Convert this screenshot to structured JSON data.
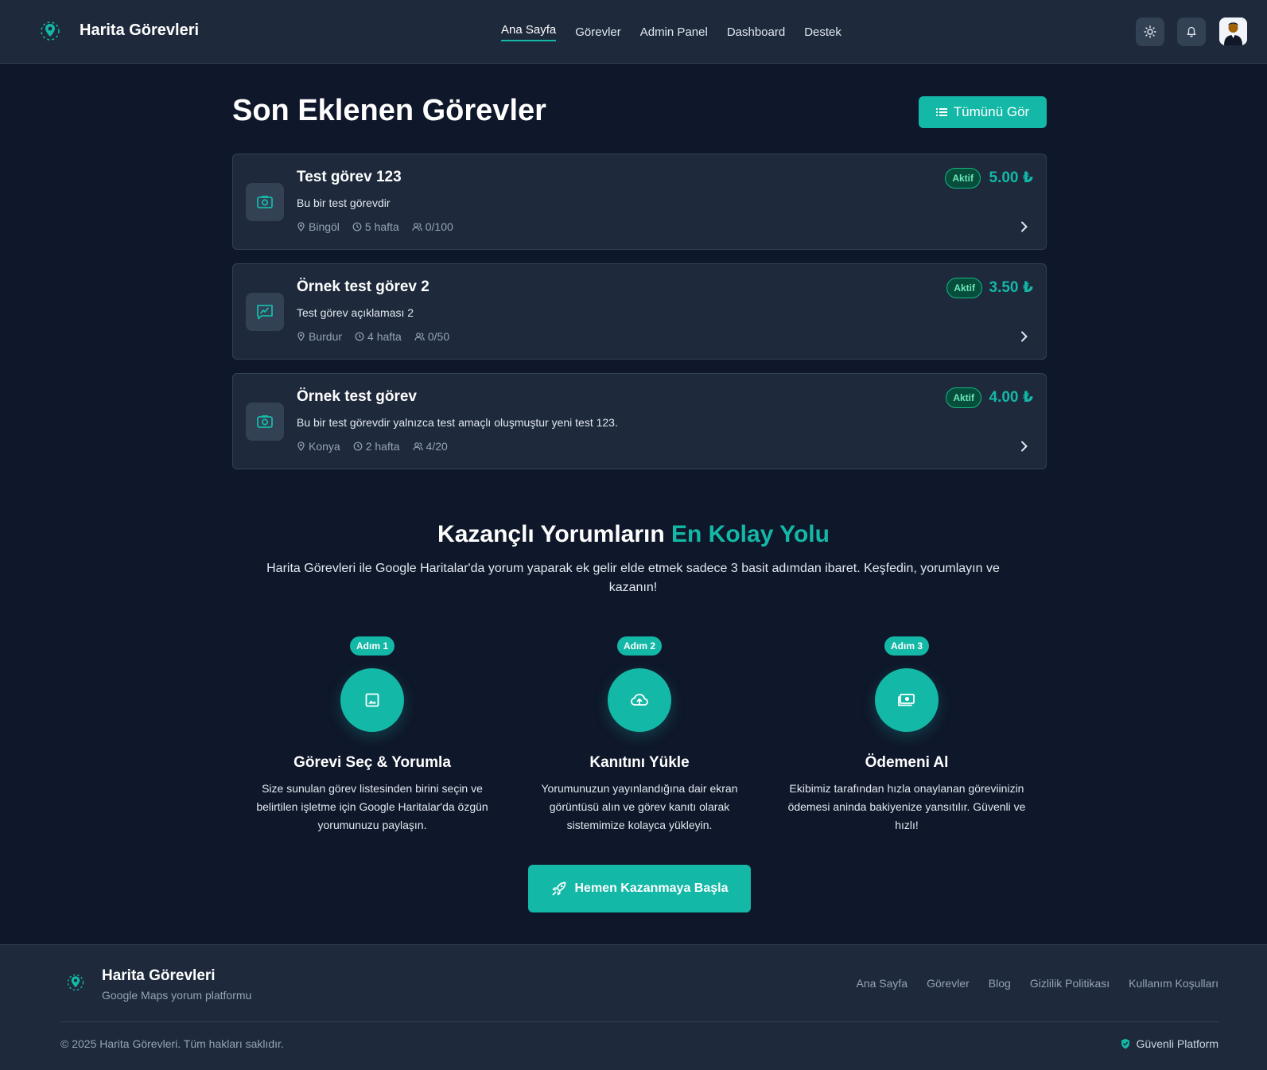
{
  "header": {
    "brand": "Harita Görevleri",
    "nav": [
      "Ana Sayfa",
      "Görevler",
      "Admin Panel",
      "Dashboard",
      "Destek"
    ],
    "active_nav": "Ana Sayfa"
  },
  "recent": {
    "title": "Son Eklenen Görevler",
    "see_all": "Tümünü Gör"
  },
  "tasks": [
    {
      "title": "Test görev 123",
      "description": "Bu bir test görevdir",
      "location": "Bingöl",
      "duration": "5 hafta",
      "participants": "0/100",
      "status": "Aktif",
      "price": "5.00 ₺",
      "icon": "camera-icon"
    },
    {
      "title": "Örnek test görev 2",
      "description": "Test görev açıklaması 2",
      "location": "Burdur",
      "duration": "4 hafta",
      "participants": "0/50",
      "status": "Aktif",
      "price": "3.50 ₺",
      "icon": "review-icon"
    },
    {
      "title": "Örnek test görev",
      "description": "Bu bir test görevdir yalnızca test amaçlı oluşmuştur yeni test 123.",
      "location": "Konya",
      "duration": "2 hafta",
      "participants": "4/20",
      "status": "Aktif",
      "price": "4.00 ₺",
      "icon": "camera-icon"
    }
  ],
  "how": {
    "title_main": "Kazançlı Yorumların ",
    "title_accent": "En Kolay Yolu",
    "subtitle": "Harita Görevleri ile Google Haritalar'da yorum yaparak ek gelir elde etmek sadece 3 basit adımdan ibaret. Keşfedin, yorumlayın ve kazanın!",
    "steps": [
      {
        "badge": "Adım 1",
        "title": "Görevi Seç & Yorumla",
        "text": "Size sunulan görev listesinden birini seçin ve belirtilen işletme için Google Haritalar'da özgün yorumunuzu paylaşın.",
        "icon": "image-icon"
      },
      {
        "badge": "Adım 2",
        "title": "Kanıtını Yükle",
        "text": "Yorumunuzun yayınlandığına dair ekran görüntüsü alın ve görev kanıtı olarak sistemimize kolayca yükleyin.",
        "icon": "cloud-upload-icon"
      },
      {
        "badge": "Adım 3",
        "title": "Ödemeni Al",
        "text": "Ekibimiz tarafından hızla onaylanan göreviinizin ödemesi aninda bakiyenize yansıtılır. Güvenli ve hızlı!",
        "icon": "money-icon"
      }
    ],
    "cta": "Hemen Kazanmaya Başla"
  },
  "footer": {
    "brand": "Harita Görevleri",
    "tagline": "Google Maps yorum platformu",
    "links": [
      "Ana Sayfa",
      "Görevler",
      "Blog",
      "Gizlilik Politikası",
      "Kullanım Koşulları"
    ],
    "copyright": "© 2025 Harita Görevleri. Tüm hakları saklıdır.",
    "secure": "Güvenli Platform"
  },
  "colors": {
    "accent": "#14b8a6",
    "background": "#0f172a",
    "surface": "#1e293b",
    "status_active": "#10b981"
  }
}
